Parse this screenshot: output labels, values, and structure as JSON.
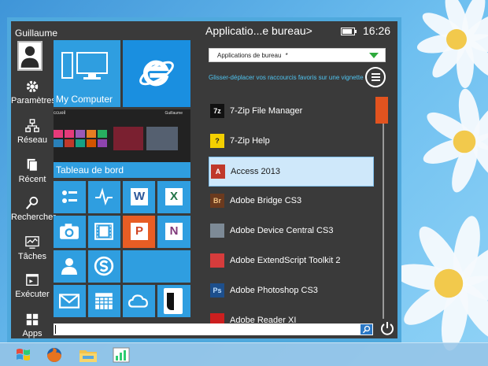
{
  "window": {
    "user": "Guillaume",
    "rail": [
      {
        "label": "Paramètres",
        "icon": "gear-icon"
      },
      {
        "label": "Réseau",
        "icon": "network-icon"
      },
      {
        "label": "Récent",
        "icon": "recent-docs-icon"
      },
      {
        "label": "Rechercher",
        "icon": "search-icon"
      },
      {
        "label": "Tâches",
        "icon": "task-manager-icon"
      },
      {
        "label": "Exécuter",
        "icon": "run-icon"
      },
      {
        "label": "Apps",
        "icon": "apps-grid-icon"
      }
    ]
  },
  "tiles": {
    "my_computer": "My Computer",
    "tableau_de_bord": "Tableau de bord",
    "preview_header": "ccueil",
    "preview_user": "Guillaume"
  },
  "panel": {
    "header": "Applicatio...e bureau>",
    "time": "16:26",
    "dropdown_value": "Applications de bureau",
    "dropdown_marker": "*",
    "hint": "Glisser-déplacer vos raccourcis favoris sur une vignette"
  },
  "apps": [
    {
      "name": "7-Zip File Manager",
      "icon": "7z",
      "color": "#111111",
      "fg": "#ffffff"
    },
    {
      "name": "7-Zip Help",
      "icon": "?",
      "color": "#f4d000",
      "fg": "#222222"
    },
    {
      "name": "Access 2013",
      "icon": "A",
      "color": "#c0392b",
      "fg": "#ffffff"
    },
    {
      "name": "Adobe Bridge CS3",
      "icon": "Br",
      "color": "#6b3a1e",
      "fg": "#f0c080"
    },
    {
      "name": "Adobe Device Central CS3",
      "icon": "",
      "color": "#7d8a96",
      "fg": "#ffffff"
    },
    {
      "name": "Adobe ExtendScript Toolkit 2",
      "icon": "",
      "color": "#d63c3c",
      "fg": "#ffffff"
    },
    {
      "name": "Adobe Photoshop CS3",
      "icon": "Ps",
      "color": "#1d4f8c",
      "fg": "#bfe0ff"
    },
    {
      "name": "Adobe Reader XI",
      "icon": "",
      "color": "#cc1f1f",
      "fg": "#ffffff"
    }
  ],
  "search": {
    "value": ""
  },
  "colors": {
    "accent": "#4fa9dd",
    "menu_bg": "#3a3a3a",
    "selection": "#cfe8fa",
    "scroll_thumb": "#e2531f"
  }
}
